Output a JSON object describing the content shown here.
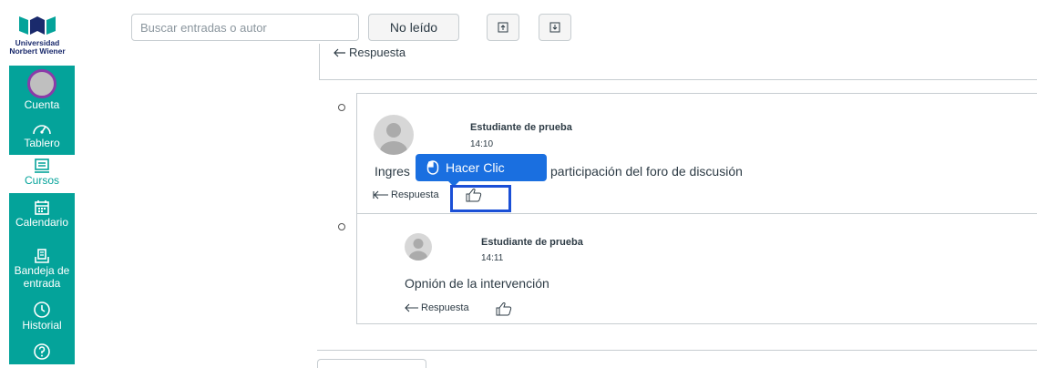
{
  "logo": {
    "line1": "Universidad",
    "line2": "Norbert Wiener"
  },
  "nav": [
    {
      "label": "Cuenta",
      "icon": "avatar-icon"
    },
    {
      "label": "Tablero",
      "icon": "dashboard-icon"
    },
    {
      "label": "Cursos",
      "icon": "courses-icon",
      "active": true
    },
    {
      "label": "Calendario",
      "icon": "calendar-icon"
    },
    {
      "label_line1": "Bandeja de",
      "label_line2": "entrada",
      "icon": "inbox-icon"
    },
    {
      "label": "Historial",
      "icon": "history-icon"
    },
    {
      "label": "",
      "icon": "help-icon"
    }
  ],
  "toolbar": {
    "search_placeholder": "Buscar entradas o autor",
    "unread_label": "No leído",
    "collapse_icon": "collapse-icon",
    "expand_icon": "expand-icon"
  },
  "top_reply_label": "Respuesta",
  "entries": [
    {
      "author": "Estudiante de prueba",
      "time": "14:10",
      "message_start": "Ingres",
      "message_end": "participación del foro de discusión",
      "reply_label": "Respuesta"
    },
    {
      "author": "Estudiante de prueba",
      "time": "14:11",
      "message": "Opnión de la intervención",
      "reply_label": "Respuesta"
    }
  ],
  "tooltip": {
    "label": "Hacer Clic",
    "icon": "mouse-icon"
  },
  "colors": {
    "nav_bg": "#04a39a",
    "tooltip_bg": "#1a6fe0",
    "highlight": "#1a4fd6",
    "avatar_ring": "#8b3ba8"
  }
}
